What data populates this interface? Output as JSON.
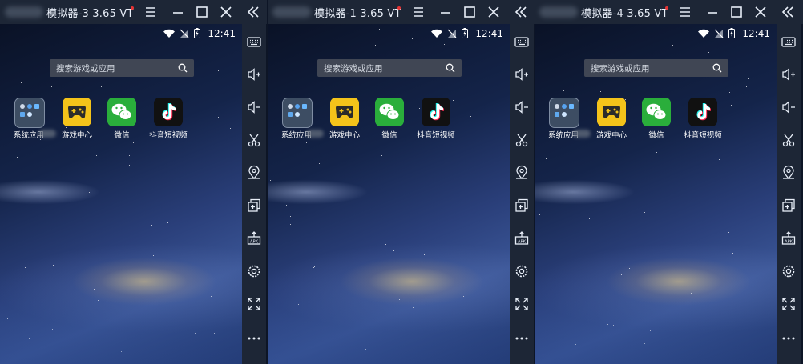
{
  "emulators": [
    {
      "id": "emu-3",
      "title": "模拟器-3 3.65 VT",
      "clock": "12:41",
      "search_placeholder": "搜索游戏或应用",
      "apps": [
        {
          "label": "系统应用",
          "icon": "system-apps-folder-icon"
        },
        {
          "label": "游戏中心",
          "icon": "game-center-icon"
        },
        {
          "label": "微信",
          "icon": "wechat-icon"
        },
        {
          "label": "抖音短视频",
          "icon": "tiktok-icon"
        }
      ]
    },
    {
      "id": "emu-1",
      "title": "模拟器-1 3.65 VT",
      "clock": "12:41",
      "search_placeholder": "搜索游戏或应用",
      "apps": [
        {
          "label": "系统应用",
          "icon": "system-apps-folder-icon"
        },
        {
          "label": "游戏中心",
          "icon": "game-center-icon"
        },
        {
          "label": "微信",
          "icon": "wechat-icon"
        },
        {
          "label": "抖音短视频",
          "icon": "tiktok-icon"
        }
      ]
    },
    {
      "id": "emu-4",
      "title": "模拟器-4 3.65 VT",
      "clock": "12:41",
      "search_placeholder": "搜索游戏或应用",
      "apps": [
        {
          "label": "系统应用",
          "icon": "system-apps-folder-icon"
        },
        {
          "label": "游戏中心",
          "icon": "game-center-icon"
        },
        {
          "label": "微信",
          "icon": "wechat-icon"
        },
        {
          "label": "抖音短视频",
          "icon": "tiktok-icon"
        }
      ]
    }
  ],
  "titlebar_icons": [
    "menu-icon",
    "minimize-icon",
    "maximize-icon",
    "close-icon",
    "collapse-sidebar-icon"
  ],
  "sidebar_tools": [
    "keyboard-icon",
    "volume-up-icon",
    "volume-down-icon",
    "screenshot-scissors-icon",
    "location-icon",
    "multi-instance-icon",
    "install-apk-icon",
    "settings-icon",
    "fullscreen-icon",
    "more-icon"
  ],
  "colors": {
    "titlebar_bg": "#1d2636",
    "recording_dot": "#e63434",
    "game_icon": "#f4c31a",
    "wechat_icon": "#2aae3b",
    "search_bg": "#404654"
  }
}
